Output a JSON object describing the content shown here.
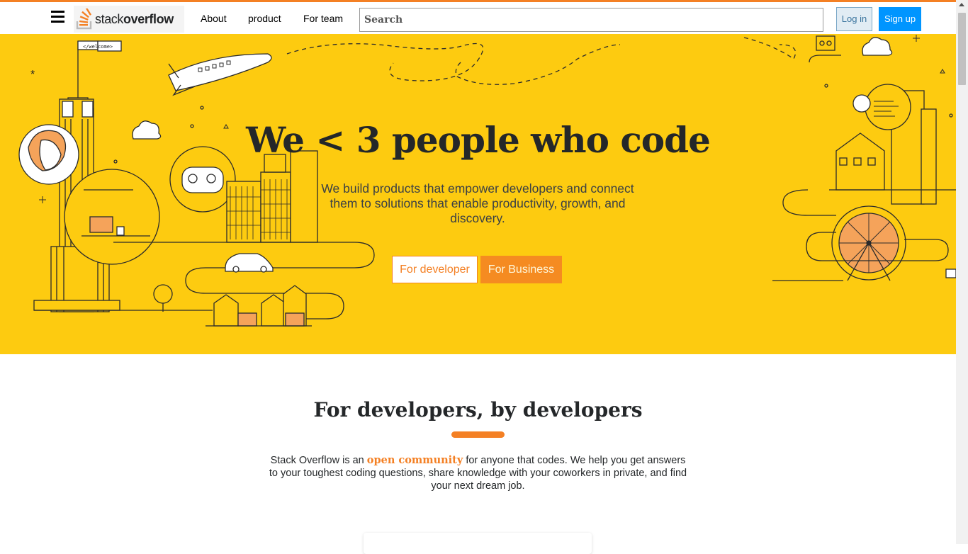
{
  "header": {
    "logo_text_light": "stack",
    "logo_text_bold": "overflow",
    "nav": [
      "About",
      "product",
      "For team"
    ],
    "search_placeholder": "Search",
    "login": "Log in",
    "signup": "Sign up",
    "accent_color": "#f48024"
  },
  "hero": {
    "title": "We < 3 people who code",
    "subtitle": "We build products that empower developers and connect them to solutions that enable productivity, growth, and discovery.",
    "btn_developer": "For developer",
    "btn_business": "For Business",
    "flag_text": "</welcome>",
    "background_color": "#fdcb10"
  },
  "section": {
    "title": "For developers, by developers",
    "intro_before": "Stack Overflow is an",
    "intro_highlight": "open community",
    "intro_after": "for anyone that codes. We help you get answers to your toughest coding questions, share knowledge with your coworkers in private, and find your next dream job."
  }
}
